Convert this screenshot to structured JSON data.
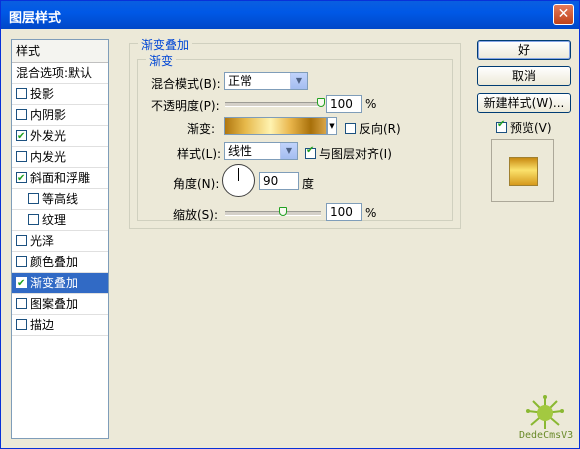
{
  "window": {
    "title": "图层样式",
    "close_glyph": "✕"
  },
  "style_list": {
    "header": "样式",
    "items": [
      {
        "label": "混合选项:默认",
        "has_checkbox": false,
        "checked": false,
        "selected": false,
        "sub": false
      },
      {
        "label": "投影",
        "has_checkbox": true,
        "checked": false,
        "selected": false,
        "sub": false
      },
      {
        "label": "内阴影",
        "has_checkbox": true,
        "checked": false,
        "selected": false,
        "sub": false
      },
      {
        "label": "外发光",
        "has_checkbox": true,
        "checked": true,
        "selected": false,
        "sub": false
      },
      {
        "label": "内发光",
        "has_checkbox": true,
        "checked": false,
        "selected": false,
        "sub": false
      },
      {
        "label": "斜面和浮雕",
        "has_checkbox": true,
        "checked": true,
        "selected": false,
        "sub": false
      },
      {
        "label": "等高线",
        "has_checkbox": true,
        "checked": false,
        "selected": false,
        "sub": true
      },
      {
        "label": "纹理",
        "has_checkbox": true,
        "checked": false,
        "selected": false,
        "sub": true
      },
      {
        "label": "光泽",
        "has_checkbox": true,
        "checked": false,
        "selected": false,
        "sub": false
      },
      {
        "label": "颜色叠加",
        "has_checkbox": true,
        "checked": false,
        "selected": false,
        "sub": false
      },
      {
        "label": "渐变叠加",
        "has_checkbox": true,
        "checked": true,
        "selected": true,
        "sub": false
      },
      {
        "label": "图案叠加",
        "has_checkbox": true,
        "checked": false,
        "selected": false,
        "sub": false
      },
      {
        "label": "描边",
        "has_checkbox": true,
        "checked": false,
        "selected": false,
        "sub": false
      }
    ]
  },
  "panel": {
    "group_title": "渐变叠加",
    "subgroup_title": "渐变",
    "blend_mode": {
      "label": "混合模式(B):",
      "value": "正常"
    },
    "opacity": {
      "label": "不透明度(P):",
      "value": "100",
      "unit": "%",
      "level": 1.0
    },
    "gradient": {
      "label": "渐变:",
      "reverse_label": "反向(R)",
      "reverse_checked": false
    },
    "style": {
      "label": "样式(L):",
      "value": "线性",
      "align_label": "与图层对齐(I)",
      "align_checked": true
    },
    "angle": {
      "label": "角度(N):",
      "value": "90",
      "unit": "度"
    },
    "scale": {
      "label": "缩放(S):",
      "value": "100",
      "unit": "%",
      "level": 0.6
    }
  },
  "buttons": {
    "ok": "好",
    "cancel": "取消",
    "new_style": "新建样式(W)...",
    "preview_label": "预览(V)",
    "preview_checked": true
  },
  "watermark": {
    "text": "DedeCmsV3"
  },
  "colors": {
    "title_bar": "#0058e6",
    "selection": "#316ac5",
    "group_title": "#0046d5"
  }
}
